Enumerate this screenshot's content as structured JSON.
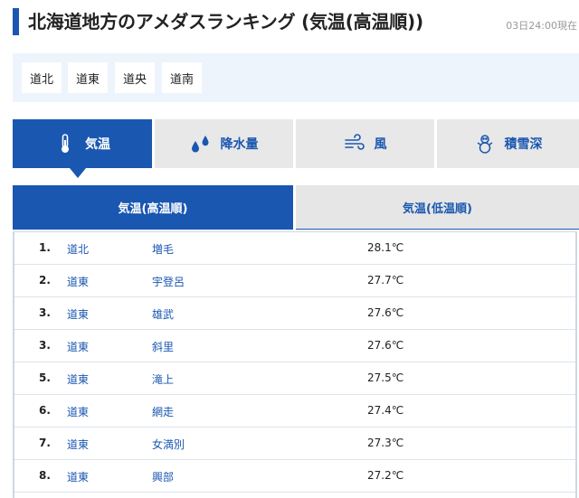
{
  "header": {
    "title": "北海道地方のアメダスランキング (気温(高温順))",
    "timestamp": "03日24:00現在"
  },
  "regions": [
    "道北",
    "道東",
    "道央",
    "道南"
  ],
  "categories": [
    {
      "label": "気温",
      "icon": "thermometer-icon",
      "active": true
    },
    {
      "label": "降水量",
      "icon": "raindrops-icon",
      "active": false
    },
    {
      "label": "風",
      "icon": "wind-icon",
      "active": false
    },
    {
      "label": "積雪深",
      "icon": "snowman-icon",
      "active": false
    }
  ],
  "sort_tabs": {
    "high": "気温(高温順)",
    "low": "気温(低温順)"
  },
  "colors": {
    "accent": "#1a57b0",
    "inactive_tab": "#e8e8e8",
    "region_bar": "#edf4fc"
  },
  "rows": [
    {
      "rank": "1.",
      "region": "道北",
      "station": "増毛",
      "value": "28.1℃"
    },
    {
      "rank": "2.",
      "region": "道東",
      "station": "宇登呂",
      "value": "27.7℃"
    },
    {
      "rank": "3.",
      "region": "道東",
      "station": "雄武",
      "value": "27.6℃"
    },
    {
      "rank": "3.",
      "region": "道東",
      "station": "斜里",
      "value": "27.6℃"
    },
    {
      "rank": "5.",
      "region": "道東",
      "station": "滝上",
      "value": "27.5℃"
    },
    {
      "rank": "6.",
      "region": "道東",
      "station": "網走",
      "value": "27.4℃"
    },
    {
      "rank": "7.",
      "region": "道東",
      "station": "女満別",
      "value": "27.3℃"
    },
    {
      "rank": "8.",
      "region": "道東",
      "station": "興部",
      "value": "27.2℃"
    }
  ]
}
